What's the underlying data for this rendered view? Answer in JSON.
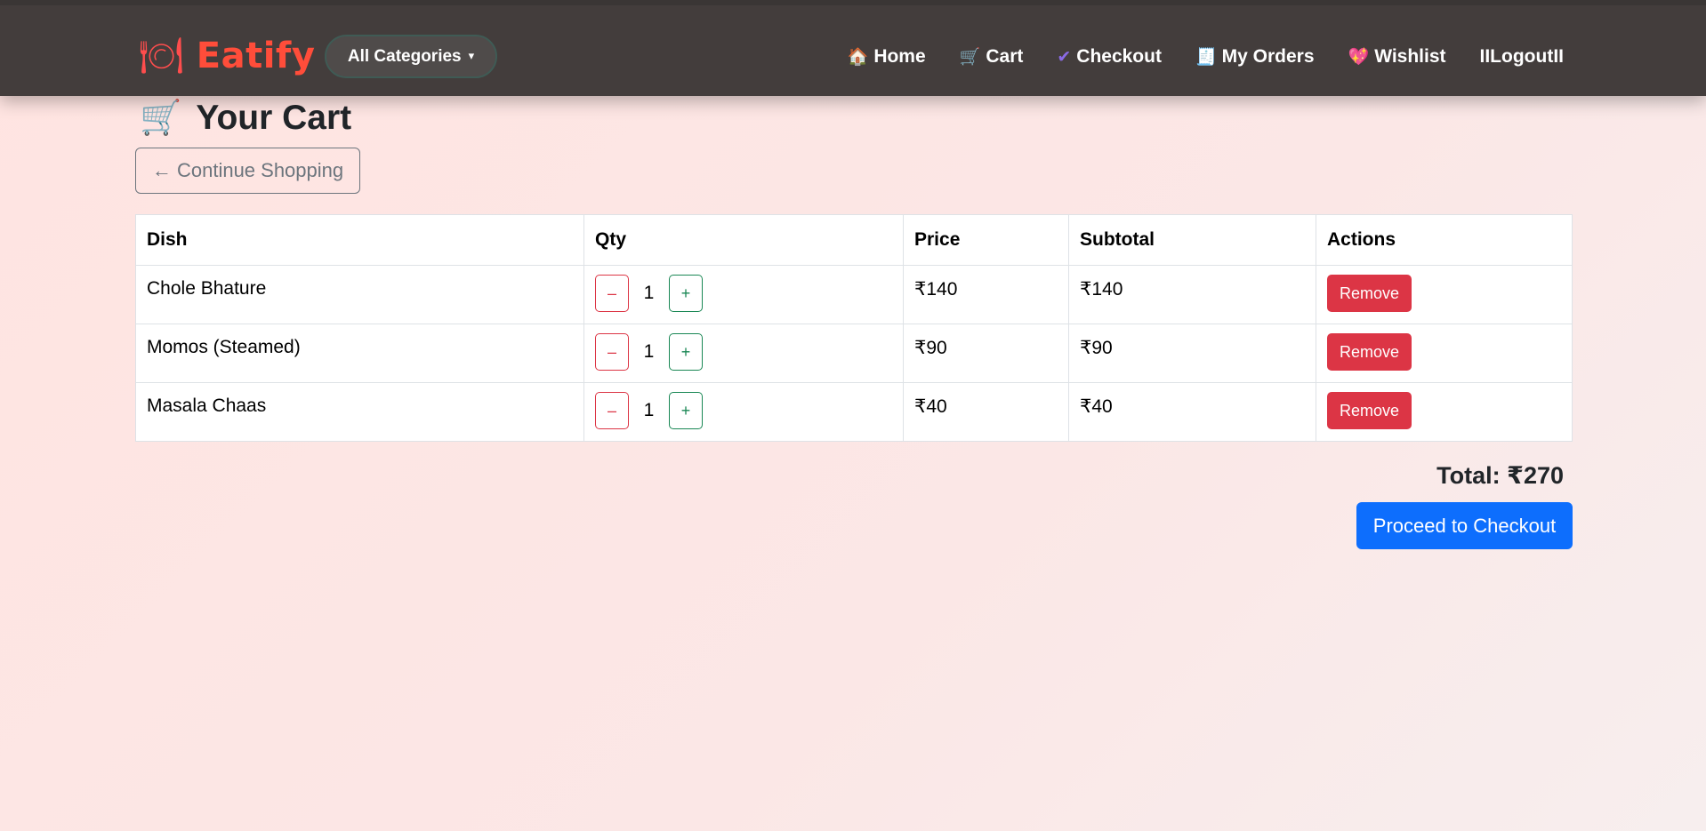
{
  "header": {
    "brand_icon": "🍽",
    "brand_name": "Eatify",
    "categories_label": "All Categories",
    "categories_chevron": "▾",
    "nav": [
      {
        "icon": "🏠",
        "icon_name": "home-icon",
        "label": "Home"
      },
      {
        "icon": "🛒",
        "icon_name": "cart-icon",
        "label": "Cart"
      },
      {
        "icon": "✔",
        "icon_name": "check-icon",
        "label": "Checkout"
      },
      {
        "icon": "🧾",
        "icon_name": "receipt-icon",
        "label": "My Orders"
      },
      {
        "icon": "💖",
        "icon_name": "heart-icon",
        "label": "Wishlist"
      },
      {
        "icon": "",
        "icon_name": "",
        "label": "IILogoutII"
      }
    ]
  },
  "page": {
    "title_icon": "🛒",
    "title": "Your Cart",
    "continue_label": "← Continue Shopping"
  },
  "table": {
    "headers": [
      "Dish",
      "Qty",
      "Price",
      "Subtotal",
      "Actions"
    ],
    "rows": [
      {
        "dish": "Chole Bhature",
        "qty": "1",
        "price": "₹140",
        "subtotal": "₹140"
      },
      {
        "dish": "Momos (Steamed)",
        "qty": "1",
        "price": "₹90",
        "subtotal": "₹90"
      },
      {
        "dish": "Masala Chaas",
        "qty": "1",
        "price": "₹40",
        "subtotal": "₹40"
      }
    ],
    "minus_label": "–",
    "plus_label": "+",
    "remove_label": "Remove"
  },
  "summary": {
    "total": "Total: ₹270",
    "checkout_label": "Proceed to Checkout"
  },
  "colors": {
    "brand": "#ff4d3a",
    "navbar": "#433d3c",
    "danger": "#dc3545",
    "success": "#198754",
    "primary": "#0d6efd"
  }
}
